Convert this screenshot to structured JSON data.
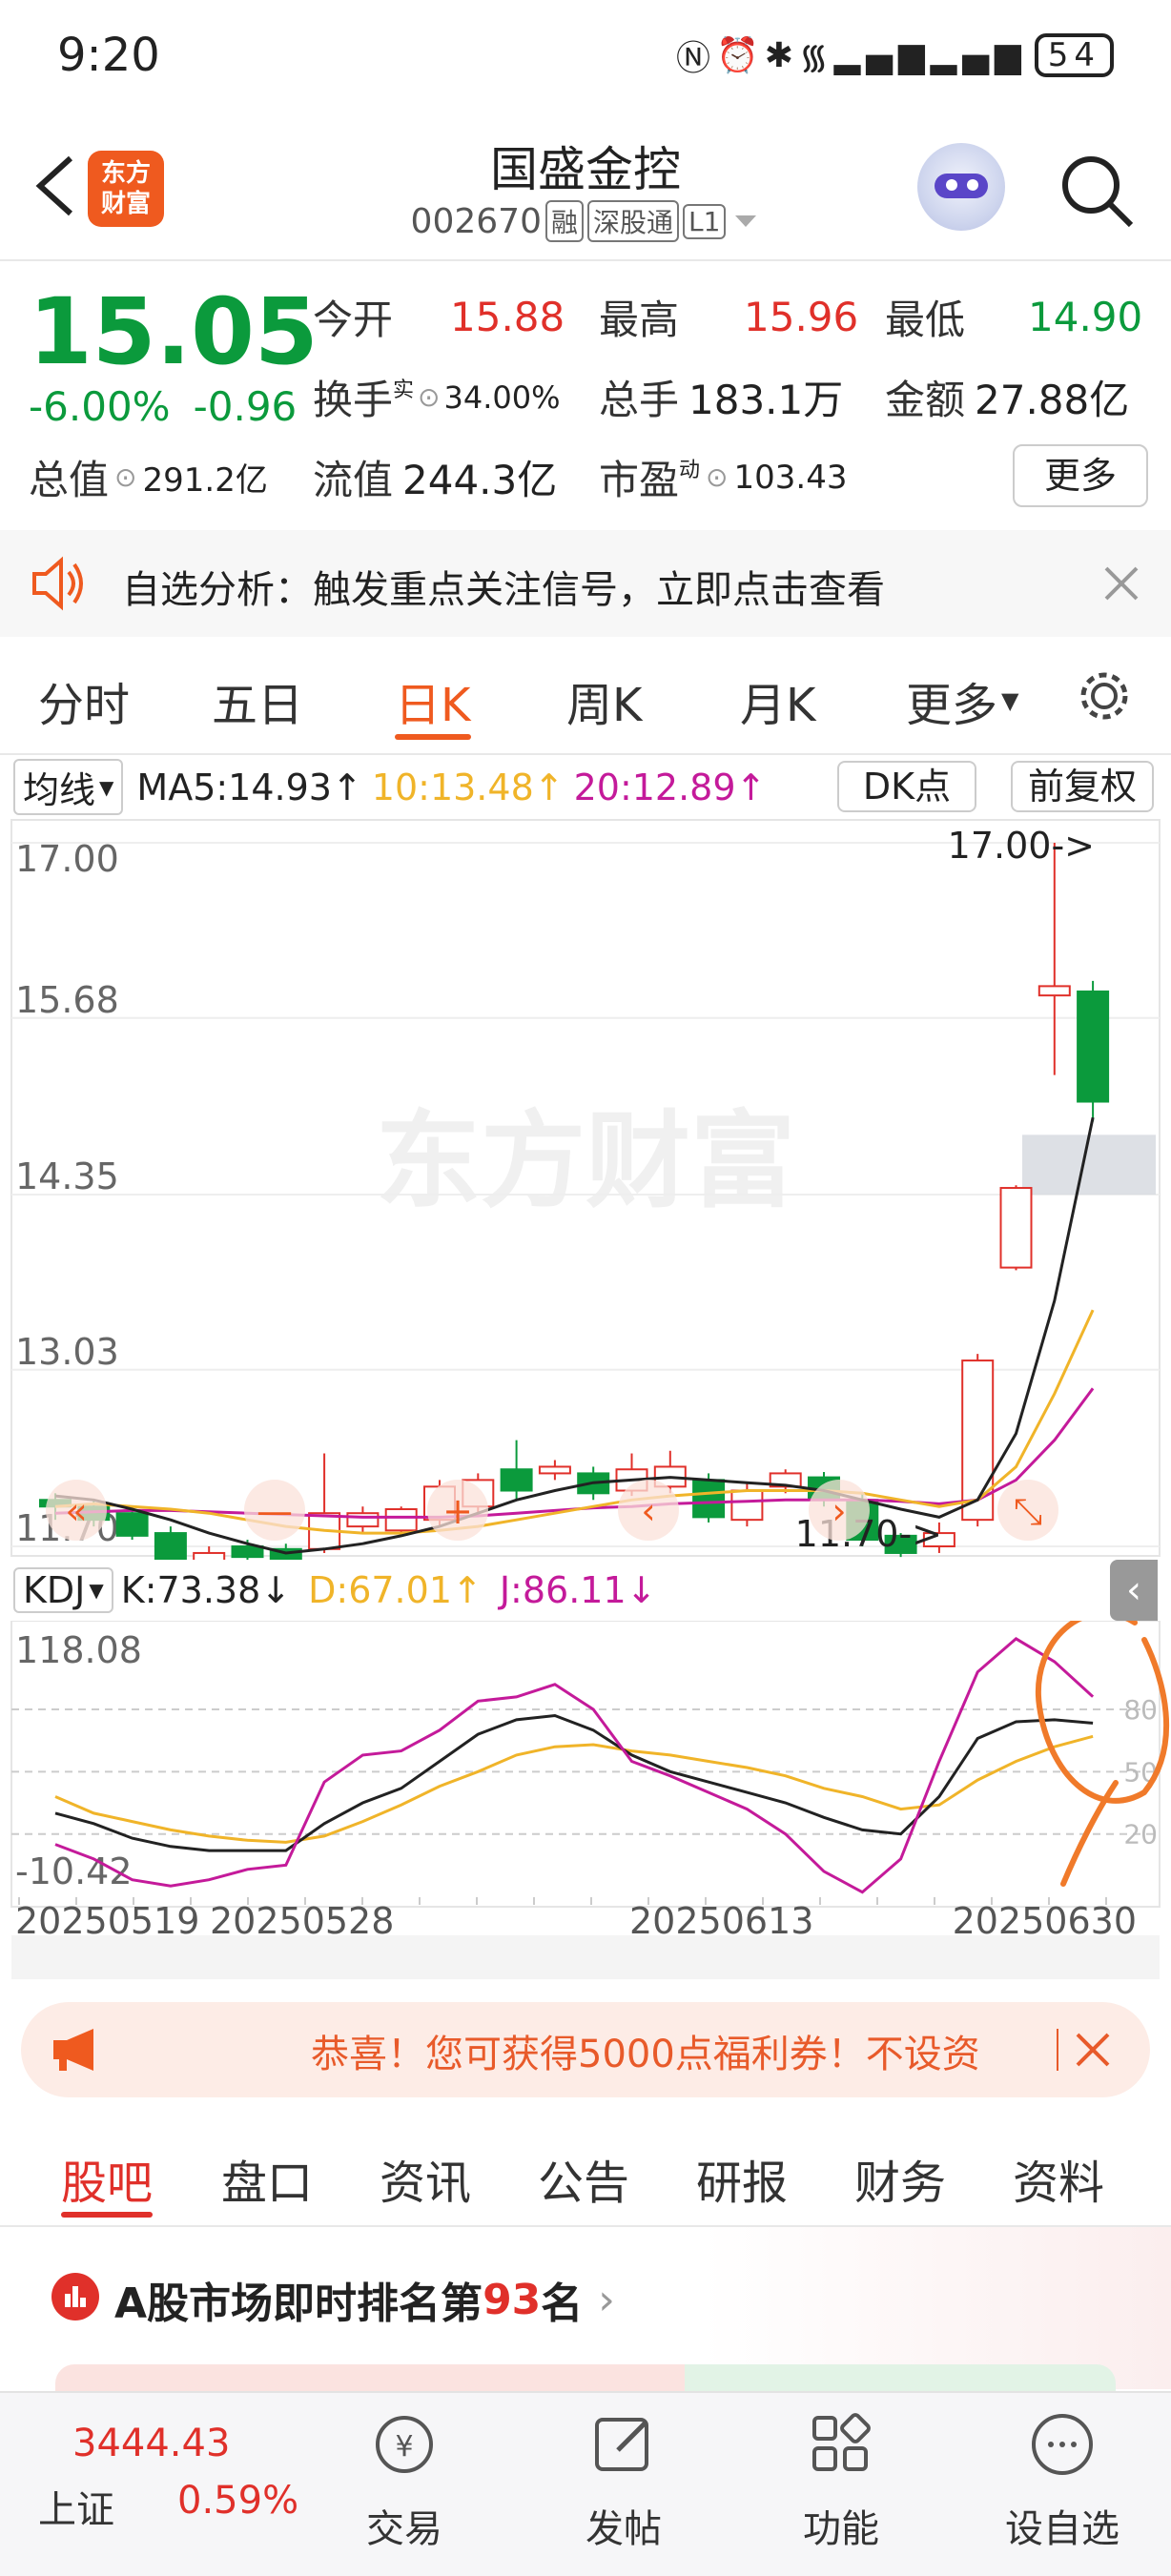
{
  "status_bar": {
    "time": "9:20",
    "icons": "N ⏰ ✱ 📶 4G 4G",
    "battery": "54"
  },
  "header": {
    "logo_text": "东方财富",
    "name": "国盛金控",
    "code": "002670",
    "tags": [
      "融",
      "深股通",
      "L1"
    ]
  },
  "quote": {
    "price": "15.05",
    "change_pct": "-6.00%",
    "change": "-0.96",
    "open_label": "今开",
    "open": "15.88",
    "high_label": "最高",
    "high": "15.96",
    "low_label": "最低",
    "low": "14.90",
    "turnover_label": "换手",
    "turnover_sup": "实",
    "turnover": "34.00%",
    "volume_label": "总手",
    "volume": "183.1万",
    "amount_label": "金额",
    "amount": "27.88亿",
    "mktcap_label": "总值",
    "mktcap": "291.2亿",
    "float_label": "流值",
    "float": "244.3亿",
    "pe_label": "市盈",
    "pe_sup": "动",
    "pe": "103.43",
    "more": "更多"
  },
  "notice": {
    "text": "自选分析：触发重点关注信号，立即点击查看"
  },
  "tabs": [
    "分时",
    "五日",
    "日K",
    "周K",
    "月K",
    "更多"
  ],
  "active_tab": "日K",
  "chart_header": {
    "ma_select": "均线",
    "ma5": "MA5:14.93",
    "ma10": "10:13.48",
    "ma20": "20:12.89",
    "dk": "DK点",
    "fq": "前复权"
  },
  "kdj_header": {
    "select": "KDJ",
    "k": "K:73.38",
    "d": "D:67.01",
    "j": "J:86.11"
  },
  "watermark": "东方财富",
  "colors": {
    "up": "#e0302a",
    "down": "#0b9a3c",
    "ma5": "#222222",
    "ma10": "#f0b429",
    "ma20": "#c41a9a",
    "accent": "#ef5a1f"
  },
  "chart_data": {
    "type": "candlestick",
    "y_ticks": [
      "17.00",
      "15.68",
      "14.35",
      "13.03",
      "11.70"
    ],
    "ylim": [
      11.7,
      17.0
    ],
    "annotations": [
      "17.00->",
      "11.70->"
    ],
    "x_ticks": [
      "20250519",
      "20250528",
      "20250613",
      "20250630"
    ],
    "candles": [
      {
        "o": 12.05,
        "c": 12.0,
        "h": 12.1,
        "l": 11.9
      },
      {
        "o": 12.0,
        "c": 11.9,
        "h": 12.05,
        "l": 11.85
      },
      {
        "o": 11.95,
        "c": 11.78,
        "h": 12.0,
        "l": 11.75
      },
      {
        "o": 11.8,
        "c": 11.55,
        "h": 11.85,
        "l": 11.5
      },
      {
        "o": 11.55,
        "c": 11.65,
        "h": 11.7,
        "l": 11.5
      },
      {
        "o": 11.7,
        "c": 11.62,
        "h": 11.75,
        "l": 11.58
      },
      {
        "o": 11.68,
        "c": 11.6,
        "h": 11.72,
        "l": 11.55
      },
      {
        "o": 11.68,
        "c": 11.95,
        "h": 12.4,
        "l": 11.65
      },
      {
        "o": 11.85,
        "c": 11.95,
        "h": 12.0,
        "l": 11.8
      },
      {
        "o": 11.82,
        "c": 11.98,
        "h": 12.0,
        "l": 11.78
      },
      {
        "o": 11.9,
        "c": 12.15,
        "h": 12.2,
        "l": 11.85
      },
      {
        "o": 12.0,
        "c": 12.2,
        "h": 12.25,
        "l": 11.95
      },
      {
        "o": 12.28,
        "c": 12.12,
        "h": 12.5,
        "l": 12.05
      },
      {
        "o": 12.25,
        "c": 12.3,
        "h": 12.35,
        "l": 12.2
      },
      {
        "o": 12.25,
        "c": 12.1,
        "h": 12.3,
        "l": 12.05
      },
      {
        "o": 12.12,
        "c": 12.28,
        "h": 12.4,
        "l": 12.08
      },
      {
        "o": 12.15,
        "c": 12.3,
        "h": 12.42,
        "l": 12.1
      },
      {
        "o": 12.2,
        "c": 11.92,
        "h": 12.25,
        "l": 11.88
      },
      {
        "o": 11.9,
        "c": 12.12,
        "h": 12.18,
        "l": 11.85
      },
      {
        "o": 12.15,
        "c": 12.25,
        "h": 12.28,
        "l": 12.1
      },
      {
        "o": 12.22,
        "c": 12.05,
        "h": 12.26,
        "l": 12.0
      },
      {
        "o": 12.05,
        "c": 11.75,
        "h": 12.1,
        "l": 11.7
      },
      {
        "o": 11.78,
        "c": 11.65,
        "h": 11.8,
        "l": 11.62
      },
      {
        "o": 11.7,
        "c": 11.8,
        "h": 11.88,
        "l": 11.65
      },
      {
        "o": 11.9,
        "c": 13.1,
        "h": 13.15,
        "l": 11.85
      },
      {
        "o": 13.8,
        "c": 14.4,
        "h": 14.42,
        "l": 13.78
      },
      {
        "o": 15.85,
        "c": 15.92,
        "h": 17.0,
        "l": 15.25
      },
      {
        "o": 15.88,
        "c": 15.05,
        "h": 15.96,
        "l": 14.9
      }
    ],
    "ma5": [
      12.08,
      12.05,
      11.98,
      11.9,
      11.8,
      11.72,
      11.65,
      11.68,
      11.72,
      11.78,
      11.85,
      11.95,
      12.05,
      12.12,
      12.18,
      12.2,
      12.22,
      12.2,
      12.18,
      12.16,
      12.12,
      12.05,
      11.98,
      11.92,
      12.05,
      12.55,
      13.55,
      14.93
    ],
    "ma10": [
      12.0,
      12.02,
      12.0,
      11.98,
      11.95,
      11.9,
      11.85,
      11.82,
      11.8,
      11.8,
      11.82,
      11.85,
      11.9,
      11.95,
      12.0,
      12.05,
      12.08,
      12.1,
      12.12,
      12.12,
      12.12,
      12.1,
      12.05,
      12.0,
      12.05,
      12.3,
      12.85,
      13.48
    ],
    "ma20": [
      11.95,
      11.96,
      11.97,
      11.97,
      11.96,
      11.95,
      11.94,
      11.93,
      11.92,
      11.92,
      11.92,
      11.93,
      11.95,
      11.97,
      11.99,
      12.0,
      12.02,
      12.03,
      12.04,
      12.05,
      12.05,
      12.05,
      12.04,
      12.02,
      12.05,
      12.2,
      12.5,
      12.89
    ],
    "kdj": {
      "y_ticks": [
        "118.08",
        "-10.42"
      ],
      "ylim": [
        -10.42,
        118.08
      ],
      "levels": [
        "80",
        "50",
        "20"
      ],
      "k": [
        30,
        25,
        18,
        14,
        12,
        12,
        12,
        25,
        35,
        42,
        55,
        68,
        75,
        77,
        70,
        58,
        50,
        45,
        40,
        35,
        28,
        22,
        20,
        38,
        66,
        74,
        75,
        73.38
      ],
      "d": [
        38,
        30,
        26,
        22,
        19,
        17,
        16,
        19,
        26,
        34,
        43,
        50,
        58,
        62,
        63,
        60,
        58,
        55,
        52,
        48,
        42,
        38,
        32,
        34,
        46,
        55,
        62,
        67.01
      ],
      "j": [
        15,
        8,
        -2,
        -5,
        -2,
        3,
        5,
        45,
        58,
        60,
        70,
        84,
        86,
        92,
        80,
        55,
        48,
        40,
        32,
        20,
        2,
        -8,
        8,
        55,
        98,
        114,
        103,
        86.11
      ]
    }
  },
  "banner": {
    "text": "恭喜！您可获得5000点福利券！不设资"
  },
  "bottom_tabs": [
    "股吧",
    "盘口",
    "资讯",
    "公告",
    "研报",
    "财务",
    "资料"
  ],
  "rank": {
    "prefix": "A股市场即时排名第",
    "rank": "93",
    "suffix": "名"
  },
  "bottom_nav": {
    "index_value": "3444.43",
    "index_name": "上证",
    "index_change": "0.59%",
    "items": [
      "交易",
      "发帖",
      "功能",
      "设自选"
    ]
  }
}
